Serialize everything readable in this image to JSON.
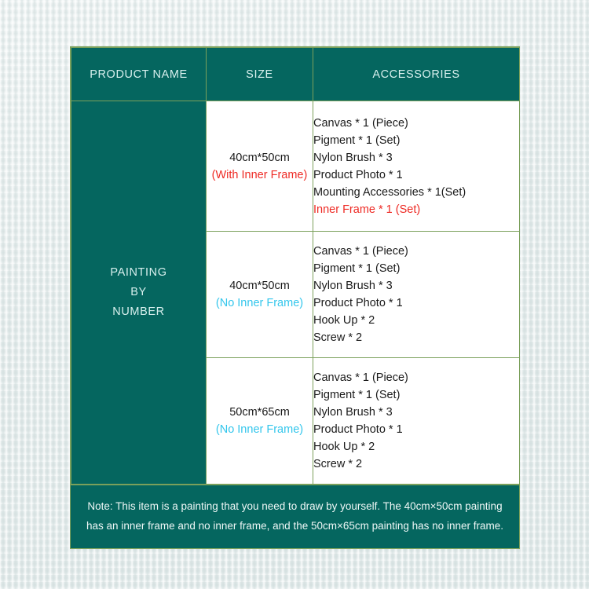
{
  "table": {
    "headers": {
      "product_name": "PRODUCT NAME",
      "size": "SIZE",
      "accessories": "ACCESSORIES"
    },
    "product_name": {
      "line1": "PAINTING",
      "line2": "BY",
      "line3": "NUMBER"
    },
    "rows": [
      {
        "size": {
          "dimension": "40cm*50cm",
          "frame_note": "(With Inner Frame)",
          "frame_note_color": "#ee2a24"
        },
        "accessories": [
          {
            "text": "Canvas * 1 (Piece)",
            "color": "#1a1a1a"
          },
          {
            "text": "Pigment * 1 (Set)",
            "color": "#1a1a1a"
          },
          {
            "text": "Nylon Brush * 3",
            "color": "#1a1a1a"
          },
          {
            "text": "Product Photo * 1",
            "color": "#1a1a1a"
          },
          {
            "text": "Mounting Accessories * 1(Set)",
            "color": "#1a1a1a"
          },
          {
            "text": "Inner Frame * 1 (Set)",
            "color": "#ee2a24"
          }
        ]
      },
      {
        "size": {
          "dimension": "40cm*50cm",
          "frame_note": "(No Inner Frame)",
          "frame_note_color": "#33c6ec"
        },
        "accessories": [
          {
            "text": "Canvas * 1 (Piece)",
            "color": "#1a1a1a"
          },
          {
            "text": "Pigment * 1 (Set)",
            "color": "#1a1a1a"
          },
          {
            "text": "Nylon Brush * 3",
            "color": "#1a1a1a"
          },
          {
            "text": "Product Photo * 1",
            "color": "#1a1a1a"
          },
          {
            "text": "Hook Up * 2",
            "color": "#1a1a1a"
          },
          {
            "text": "Screw * 2",
            "color": "#1a1a1a"
          }
        ]
      },
      {
        "size": {
          "dimension": "50cm*65cm",
          "frame_note": "(No Inner Frame)",
          "frame_note_color": "#33c6ec"
        },
        "accessories": [
          {
            "text": "Canvas * 1 (Piece)",
            "color": "#1a1a1a"
          },
          {
            "text": "Pigment * 1 (Set)",
            "color": "#1a1a1a"
          },
          {
            "text": "Nylon Brush * 3",
            "color": "#1a1a1a"
          },
          {
            "text": "Product Photo * 1",
            "color": "#1a1a1a"
          },
          {
            "text": "Hook Up * 2",
            "color": "#1a1a1a"
          },
          {
            "text": "Screw * 2",
            "color": "#1a1a1a"
          }
        ]
      }
    ]
  },
  "note": {
    "line1": "Note: This item is a painting that you need to draw by yourself. The 40cm×50cm painting",
    "line2": "has an inner frame and no inner frame, and the 50cm×65cm painting has no inner frame."
  },
  "colors": {
    "teal": "#05665f",
    "border_green": "#7ba05b",
    "header_text": "#d8f0ee",
    "red": "#ee2a24",
    "cyan": "#33c6ec",
    "body_text": "#1a1a1a",
    "background": "#e6edec"
  }
}
